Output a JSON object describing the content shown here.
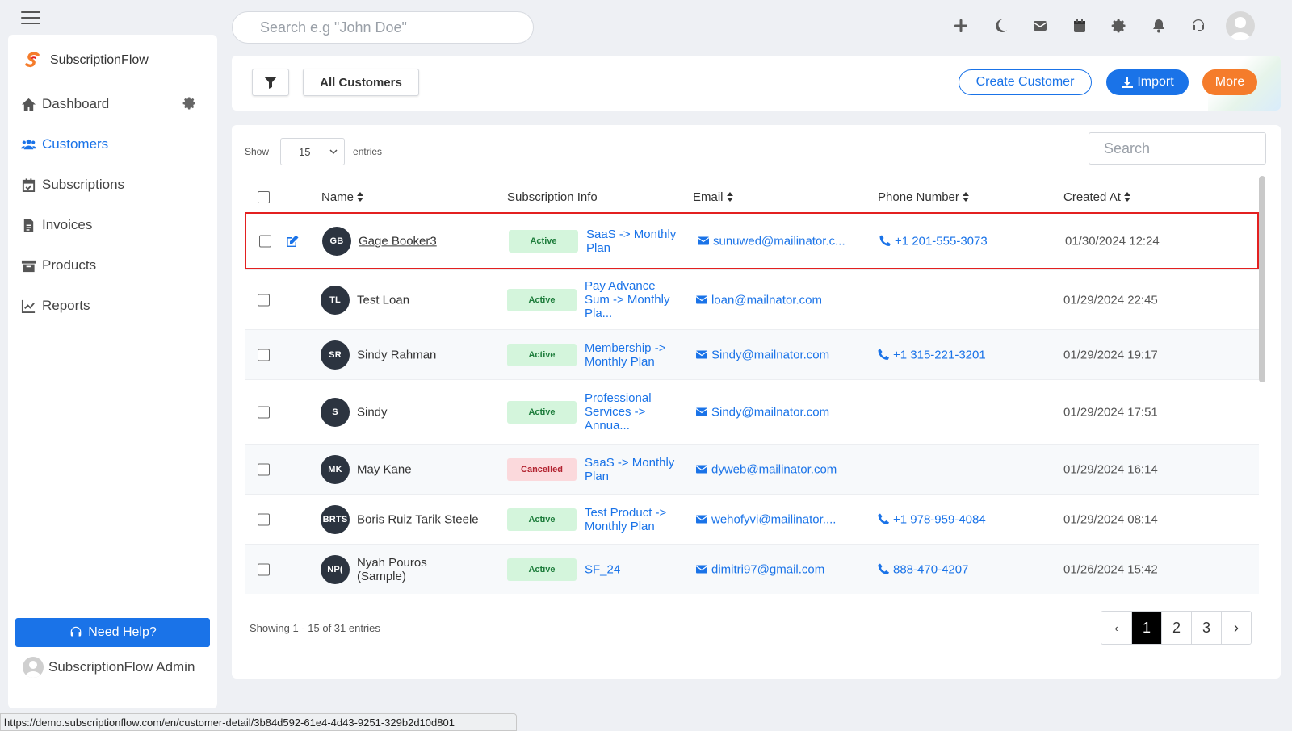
{
  "topbar": {
    "search_placeholder": "Search e.g \"John Doe\"",
    "icons": [
      "plus-icon",
      "moon-icon",
      "mail-icon",
      "calendar-icon",
      "gear-icon",
      "bell-icon",
      "headset-icon",
      "user-avatar"
    ]
  },
  "sidebar": {
    "brand": "SubscriptionFlow",
    "items": [
      {
        "label": "Dashboard",
        "icon": "home-icon"
      },
      {
        "label": "Customers",
        "icon": "users-icon"
      },
      {
        "label": "Subscriptions",
        "icon": "calendar-check-icon"
      },
      {
        "label": "Invoices",
        "icon": "invoice-icon"
      },
      {
        "label": "Products",
        "icon": "archive-icon"
      },
      {
        "label": "Reports",
        "icon": "chart-icon"
      }
    ],
    "help_label": "Need Help?",
    "admin_name": "SubscriptionFlow Admin",
    "accent": "#1a73e8"
  },
  "header": {
    "all_customers": "All Customers",
    "create_customer": "Create Customer",
    "import": "Import",
    "more": "More",
    "more_color": "#f57c2b"
  },
  "table": {
    "show_label": "Show",
    "entries_label": "entries",
    "page_size": "15",
    "search_placeholder": "Search",
    "columns": {
      "name": "Name",
      "subscription": "Subscription Info",
      "email": "Email",
      "phone": "Phone Number",
      "created": "Created At"
    },
    "rows": [
      {
        "initials": "GB",
        "name": "Gage Booker3",
        "status": "Active",
        "plan": "SaaS -> Monthly Plan",
        "email": "sunuwed@mailinator.c...",
        "phone": "+1 201-555-3073",
        "created": "01/30/2024 12:24"
      },
      {
        "initials": "TL",
        "name": "Test Loan",
        "status": "Active",
        "plan": "Pay Advance Sum -> Monthly Pla...",
        "email": "loan@mailnator.com",
        "phone": "",
        "created": "01/29/2024 22:45"
      },
      {
        "initials": "SR",
        "name": "Sindy Rahman",
        "status": "Active",
        "plan": "Membership -> Monthly Plan",
        "email": "Sindy@mailnator.com",
        "phone": "+1 315-221-3201",
        "created": "01/29/2024 19:17"
      },
      {
        "initials": "S",
        "name": "Sindy",
        "status": "Active",
        "plan": "Professional Services -> Annua...",
        "email": "Sindy@mailnator.com",
        "phone": "",
        "created": "01/29/2024 17:51"
      },
      {
        "initials": "MK",
        "name": "May Kane",
        "status": "Cancelled",
        "plan": "SaaS -> Monthly Plan",
        "email": "dyweb@mailinator.com",
        "phone": "",
        "created": "01/29/2024 16:14"
      },
      {
        "initials": "BRTS",
        "name": "Boris Ruiz Tarik Steele",
        "status": "Active",
        "plan": "Test Product -> Monthly Plan",
        "email": "wehofyvi@mailinator....",
        "phone": "+1 978-959-4084",
        "created": "01/29/2024 08:14"
      },
      {
        "initials": "NP(",
        "name": "Nyah Pouros (Sample)",
        "status": "Active",
        "plan": "SF_24",
        "email": "dimitri97@gmail.com",
        "phone": "888-470-4207",
        "created": "01/26/2024 15:42"
      }
    ],
    "footer": "Showing 1 - 15 of 31 entries",
    "pagination": {
      "prev": "‹",
      "pages": [
        "1",
        "2",
        "3"
      ],
      "next": "›",
      "current": "1"
    },
    "highlight_color": "#e32020"
  },
  "status_bar_url": "https://demo.subscriptionflow.com/en/customer-detail/3b84d592-61e4-4d43-9251-329b2d10d801"
}
